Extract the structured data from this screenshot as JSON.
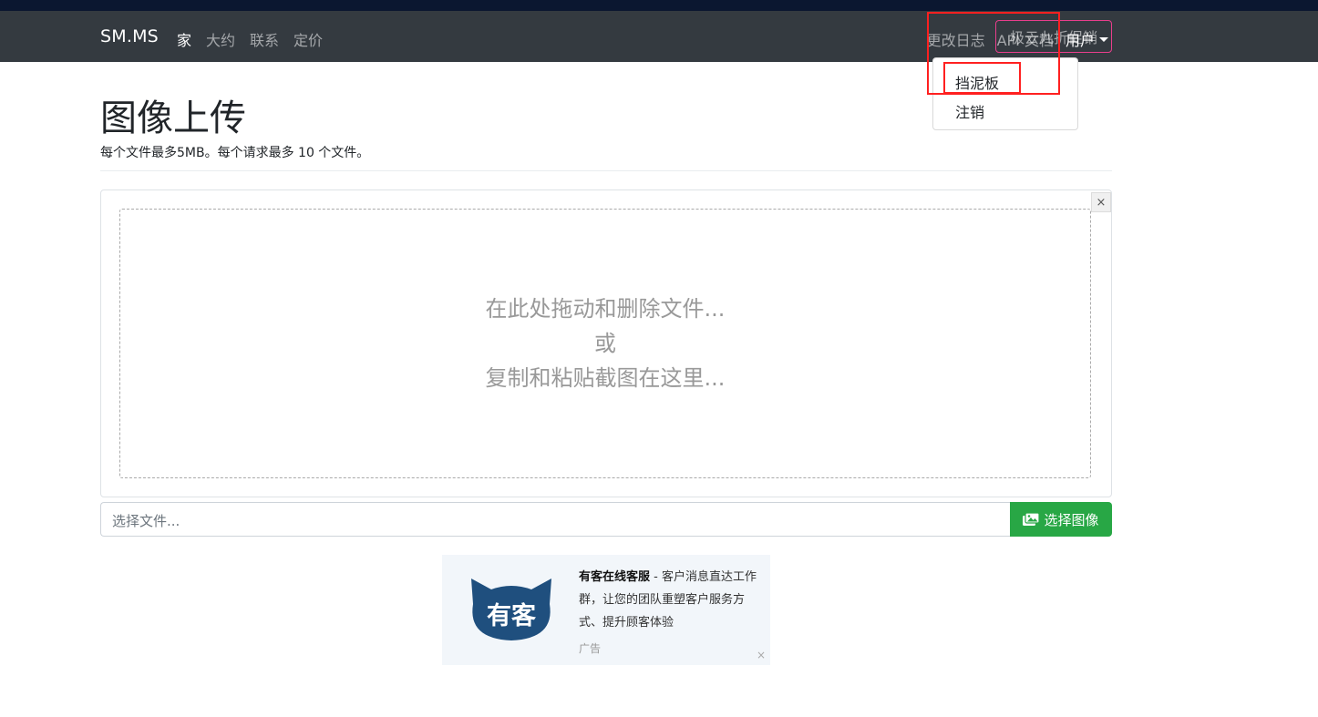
{
  "nav": {
    "brand": "SM.MS",
    "left_items": [
      "家",
      "大约",
      "联系",
      "定价"
    ],
    "right_items": [
      "更改日志",
      "API 文档"
    ],
    "user_label": "用户",
    "promo_button": "极云九折促销"
  },
  "user_menu": {
    "items": [
      "挡泥板",
      "注销"
    ]
  },
  "page": {
    "title": "图像上传",
    "subtitle": "每个文件最多5MB。每个请求最多 10 个文件。"
  },
  "dropzone": {
    "close_glyph": "×",
    "line1": "在此处拖动和删除文件...",
    "line2": "或",
    "line3": "复制和粘贴截图在这里..."
  },
  "file_input": {
    "placeholder": "选择文件...",
    "button_label": "选择图像"
  },
  "ad": {
    "logo_text": "有客",
    "headline": "有客在线客服",
    "body": " - 客户消息直达工作群，让您的团队重塑客户服务方式、提升顾客体验",
    "label": "广告",
    "close_glyph": "×"
  },
  "colors": {
    "navbar": "#343a40",
    "success": "#28a745",
    "promo_border": "#e83e8c",
    "highlight": "#ff2020",
    "ad_logo": "#1f4f7e"
  }
}
